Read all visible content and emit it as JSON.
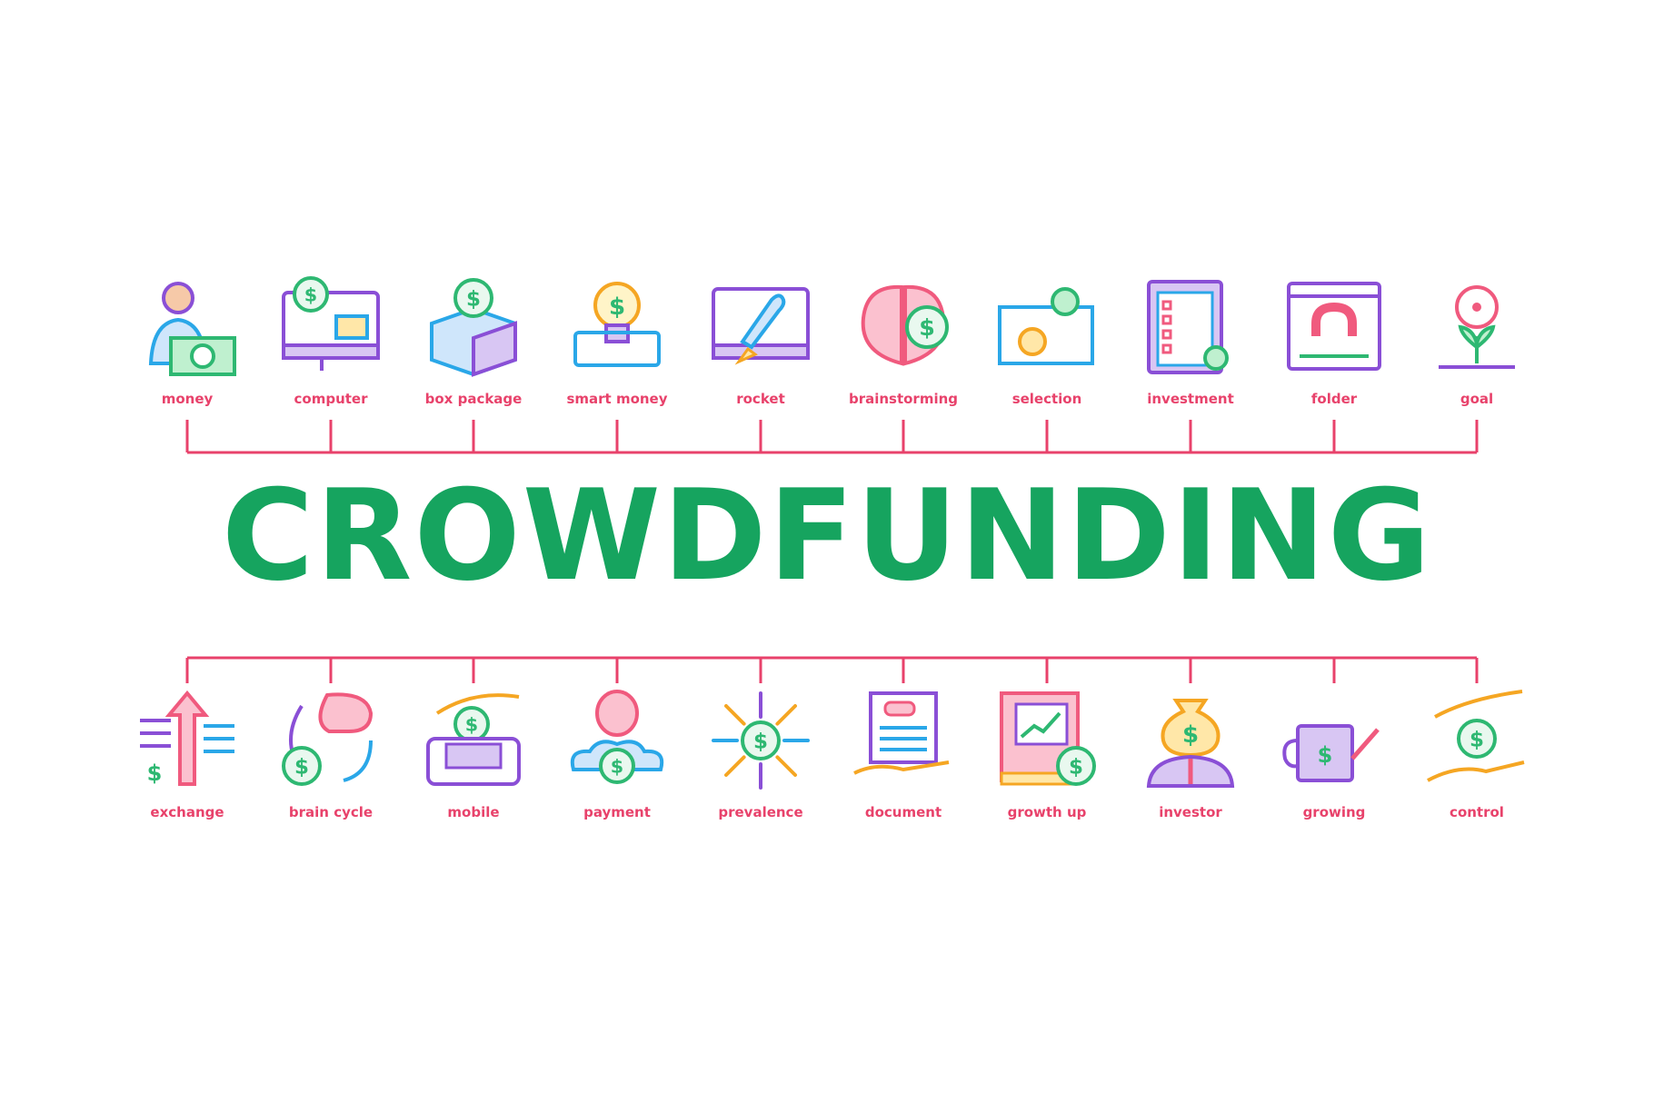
{
  "title": "CROWDFUNDING",
  "colors": {
    "title": "#16a45f",
    "label": "#e8426b",
    "connector": "#e8426b",
    "green": "#2eb872",
    "purple": "#8a4fd6",
    "blue": "#2aa7e8",
    "orange": "#f5a623",
    "pink": "#f05a7e",
    "yellow": "#f6c445"
  },
  "top_items": [
    {
      "label": "money",
      "icon": "businessman-money-icon"
    },
    {
      "label": "computer",
      "icon": "computer-briefcase-icon"
    },
    {
      "label": "box package",
      "icon": "box-coin-icon"
    },
    {
      "label": "smart money",
      "icon": "lightbulb-coin-icon"
    },
    {
      "label": "rocket",
      "icon": "rocket-monitor-icon"
    },
    {
      "label": "brainstorming",
      "icon": "brain-coin-icon"
    },
    {
      "label": "selection",
      "icon": "target-gear-icon"
    },
    {
      "label": "investment",
      "icon": "clipboard-check-icon"
    },
    {
      "label": "folder",
      "icon": "magnet-window-icon"
    },
    {
      "label": "goal",
      "icon": "target-plant-icon"
    }
  ],
  "bottom_items": [
    {
      "label": "exchange",
      "icon": "up-arrow-exchange-icon"
    },
    {
      "label": "brain cycle",
      "icon": "brain-cycle-icon"
    },
    {
      "label": "mobile",
      "icon": "mobile-hand-coin-icon"
    },
    {
      "label": "payment",
      "icon": "balloon-coin-icon"
    },
    {
      "label": "prevalence",
      "icon": "coin-arrows-icon"
    },
    {
      "label": "document",
      "icon": "hand-document-icon"
    },
    {
      "label": "growth up",
      "icon": "book-chart-icon"
    },
    {
      "label": "investor",
      "icon": "moneybag-head-icon"
    },
    {
      "label": "growing",
      "icon": "watering-can-icon"
    },
    {
      "label": "control",
      "icon": "hands-coin-icon"
    }
  ]
}
